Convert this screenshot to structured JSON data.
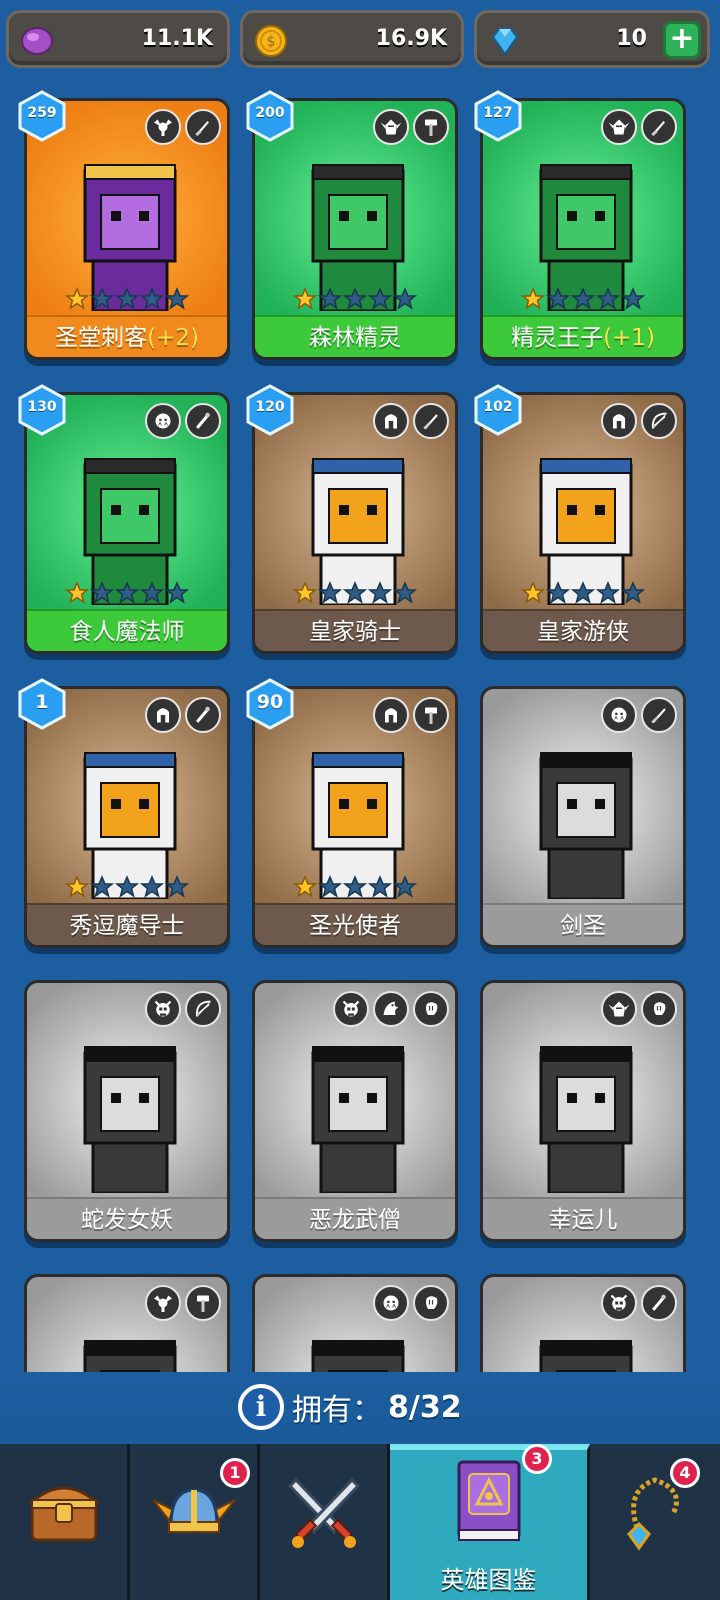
{
  "currencies": {
    "orbs": {
      "amount": "11.1K",
      "icon": "purple-orb-icon",
      "color": "#b85ad0"
    },
    "coins": {
      "amount": "16.9K",
      "icon": "gold-coin-icon",
      "color": "#f5b51a"
    },
    "gems": {
      "amount": "10",
      "icon": "blue-gem-icon",
      "color": "#3fb4f0",
      "add_label": "+"
    }
  },
  "heroes": [
    {
      "name": "圣堂刺客",
      "bonus": "(+2)",
      "level": "259",
      "rarity": "orange",
      "stars": 1,
      "unlocked": true,
      "class_icon": "winged-emblem-icon",
      "weapon_icon": "dagger-icon"
    },
    {
      "name": "森林精灵",
      "bonus": "",
      "level": "200",
      "rarity": "green",
      "stars": 1,
      "unlocked": true,
      "class_icon": "elf-icon",
      "weapon_icon": "hammer-icon"
    },
    {
      "name": "精灵王子",
      "bonus": "(+1)",
      "level": "127",
      "rarity": "green",
      "stars": 1,
      "unlocked": true,
      "class_icon": "elf-icon",
      "weapon_icon": "dagger-icon"
    },
    {
      "name": "食人魔法师",
      "bonus": "",
      "level": "130",
      "rarity": "green",
      "stars": 1,
      "unlocked": true,
      "class_icon": "orc-icon",
      "weapon_icon": "wand-icon"
    },
    {
      "name": "皇家骑士",
      "bonus": "",
      "level": "120",
      "rarity": "brown",
      "stars": 1,
      "unlocked": true,
      "class_icon": "helmet-icon",
      "weapon_icon": "sword-icon"
    },
    {
      "name": "皇家游侠",
      "bonus": "",
      "level": "102",
      "rarity": "brown",
      "stars": 1,
      "unlocked": true,
      "class_icon": "helmet-icon",
      "weapon_icon": "bow-icon"
    },
    {
      "name": "秀逗魔导士",
      "bonus": "",
      "level": "1",
      "rarity": "brown",
      "stars": 1,
      "unlocked": true,
      "class_icon": "helmet-icon",
      "weapon_icon": "wand-icon"
    },
    {
      "name": "圣光使者",
      "bonus": "",
      "level": "90",
      "rarity": "brown",
      "stars": 1,
      "unlocked": true,
      "class_icon": "helmet-icon",
      "weapon_icon": "hammer-icon"
    },
    {
      "name": "剑圣",
      "bonus": "",
      "level": "",
      "rarity": "locked",
      "stars": 0,
      "unlocked": false,
      "class_icon": "orc-icon",
      "weapon_icon": "sword-icon"
    },
    {
      "name": "蛇发女妖",
      "bonus": "",
      "level": "",
      "rarity": "locked",
      "stars": 0,
      "unlocked": false,
      "class_icon": "demon-skull-icon",
      "weapon_icon": "bow-icon"
    },
    {
      "name": "恶龙武僧",
      "bonus": "",
      "level": "",
      "rarity": "locked",
      "stars": 0,
      "unlocked": false,
      "class_icon": "demon-skull-icon",
      "weapon_icon": "fist-icon",
      "extra_icon": "dragon-icon"
    },
    {
      "name": "幸运儿",
      "bonus": "",
      "level": "",
      "rarity": "locked",
      "stars": 0,
      "unlocked": false,
      "class_icon": "elf-icon",
      "weapon_icon": "fist-icon"
    },
    {
      "name": "",
      "bonus": "",
      "level": "",
      "rarity": "locked",
      "stars": 0,
      "unlocked": false,
      "class_icon": "winged-emblem-icon",
      "weapon_icon": "hammer-icon"
    },
    {
      "name": "",
      "bonus": "",
      "level": "",
      "rarity": "locked",
      "stars": 0,
      "unlocked": false,
      "class_icon": "orc-icon",
      "weapon_icon": "fist-icon"
    },
    {
      "name": "",
      "bonus": "",
      "level": "",
      "rarity": "locked",
      "stars": 0,
      "unlocked": false,
      "class_icon": "demon-skull-icon",
      "weapon_icon": "wand-icon"
    }
  ],
  "owned": {
    "label": "拥有：",
    "value": "8/32",
    "icon": "info-icon"
  },
  "nav": [
    {
      "id": "chest",
      "icon": "treasure-chest-icon",
      "label": "",
      "badge": ""
    },
    {
      "id": "helmet",
      "icon": "winged-helmet-icon",
      "label": "",
      "badge": "1"
    },
    {
      "id": "battle",
      "icon": "crossed-swords-icon",
      "label": "",
      "badge": ""
    },
    {
      "id": "codex",
      "icon": "spellbook-icon",
      "label": "英雄图鉴",
      "badge": "3",
      "active": true
    },
    {
      "id": "amulet",
      "icon": "amulet-icon",
      "label": "",
      "badge": "4"
    }
  ]
}
